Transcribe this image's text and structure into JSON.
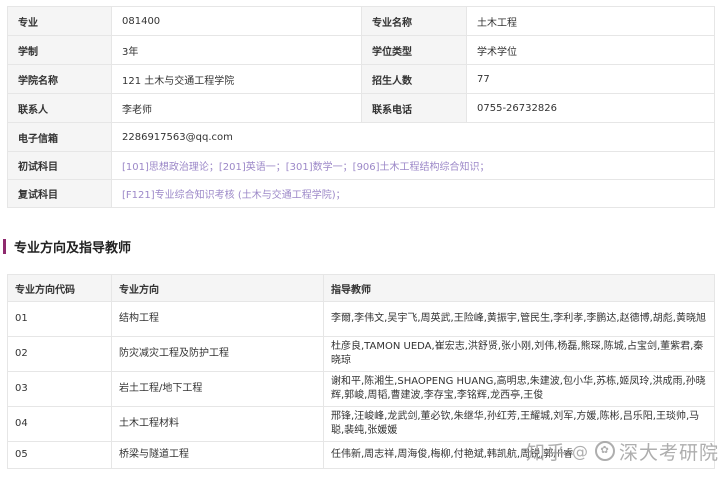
{
  "info": {
    "rows": [
      {
        "l1": "专业",
        "v1": "081400",
        "l2": "专业名称",
        "v2": "土木工程"
      },
      {
        "l1": "学制",
        "v1": "3年",
        "l2": "学位类型",
        "v2": "学术学位"
      },
      {
        "l1": "学院名称",
        "v1": "121 土木与交通工程学院",
        "l2": "招生人数",
        "v2": "77"
      },
      {
        "l1": "联系人",
        "v1": "李老师",
        "l2": "联系电话",
        "v2": "0755-26732826"
      }
    ],
    "email_label": "电子信箱",
    "email": "2286917563@qq.com",
    "first_exam_label": "初试科目",
    "first_exam_text": "[101]思想政治理论；[201]英语一；[301]数学一；",
    "first_exam_highlight": "[906]土木工程结构综合知识；",
    "retest_label": "复试科目",
    "retest_text": "[F121]专业综合知识考核 (土木与交通工程学院)；",
    "highlight_color": "#e8322f",
    "exam_text_color": "#9c88c8"
  },
  "section": {
    "title": "专业方向及指导教师",
    "accent": "#8e2a6e"
  },
  "directions": {
    "headers": [
      "专业方向代码",
      "专业方向",
      "指导教师"
    ],
    "rows": [
      {
        "code": "01",
        "name": "结构工程",
        "teachers": "李爾,李伟文,吴宇飞,周英武,王险峰,黄振宇,管民生,李利孝,李鹏达,赵德博,胡彪,黄晓旭"
      },
      {
        "code": "02",
        "name": "防灾减灾工程及防护工程",
        "teachers": "杜彦良,TAMON UEDA,崔宏志,洪舒贤,张小刚,刘伟,杨磊,熊琛,陈城,占宝剑,董紫君,秦晓琼"
      },
      {
        "code": "03",
        "name": "岩土工程/地下工程",
        "teachers": "谢和平,陈湘生,SHAOPENG HUANG,高明忠,朱建波,包小华,苏栋,姬凤玲,洪成雨,孙晓辉,郭峻,周韬,曹建波,李存宝,李铭辉,龙西亭,王俊"
      },
      {
        "code": "04",
        "name": "土木工程材料",
        "teachers": "邢锋,汪峻峰,龙武剑,董必钦,朱继华,孙红芳,王耀城,刘军,方媛,陈彬,吕乐阳,王琰帅,马聪,裴纯,张媛媛"
      },
      {
        "code": "05",
        "name": "桥梁与隧道工程",
        "teachers": "任伟新,周志祥,周海俊,梅柳,付艳斌,韩凯航,周锐,郭川睿"
      }
    ]
  },
  "watermark": {
    "brand": "知乎",
    "sep": "@",
    "author": "深大考研院"
  }
}
